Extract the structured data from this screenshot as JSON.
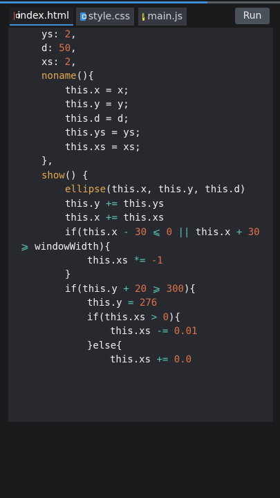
{
  "tabs": [
    {
      "label": "index.html",
      "icon": "html-file-icon",
      "active": true
    },
    {
      "label": "style.css",
      "icon": "css-file-icon",
      "active": false
    },
    {
      "label": "main.js",
      "icon": "js-file-icon",
      "active": false
    }
  ],
  "toolbar": {
    "run_label": "Run"
  },
  "colors": {
    "accent": "#3e8ede",
    "background": "#1b1b1e",
    "editor_background": "#27292e",
    "number": "#e0734c",
    "function_name": "#e4a851",
    "operator": "#59c3b3",
    "text": "#eef0f2"
  },
  "code": {
    "l1": {
      "a": "ys: ",
      "b": "2",
      "c": ","
    },
    "l2": {
      "a": "d: ",
      "b": "50",
      "c": ","
    },
    "l3": {
      "a": "xs: ",
      "b": "2",
      "c": ","
    },
    "l4": {
      "a": "noname",
      "b": "(){"
    },
    "l5": {
      "a": "this.x = x;"
    },
    "l6": {
      "a": "this.y = y;"
    },
    "l7": {
      "a": "this.d = d;"
    },
    "l8": {
      "a": "this.ys = ys;"
    },
    "l9": {
      "a": "this.xs = xs;"
    },
    "l10": {
      "a": "},"
    },
    "l11": {
      "a": "show",
      "b": "() {"
    },
    "l12": {
      "a": "ellipse",
      "b": "(this.x, this.y, this.d)"
    },
    "l13": {
      "a": "this.y ",
      "b": "+=",
      "c": " this.ys"
    },
    "l14": {
      "a": "this.x ",
      "b": "+=",
      "c": " this.xs"
    },
    "l15": {
      "a": "if(this.x ",
      "b": "-",
      "c": " ",
      "d": "30",
      "e": " ",
      "f": "⩽",
      "g": " ",
      "h": "0",
      "i": " ",
      "j": "||",
      "k": " this.x ",
      "l": "+",
      "m": " ",
      "n": "30"
    },
    "l16": {
      "a": "⩾",
      "b": " windowWidth){"
    },
    "l17": {
      "a": "this.xs ",
      "b": "*=",
      "c": " ",
      "d": "-1"
    },
    "l18": {
      "a": "}"
    },
    "l19": {
      "a": "if(this.y ",
      "b": "+",
      "c": " ",
      "d": "20",
      "e": " ",
      "f": "⩾",
      "g": " ",
      "h": "300",
      "i": "){"
    },
    "l20": {
      "a": "this.y ",
      "b": "=",
      "c": " ",
      "d": "276"
    },
    "l21": {
      "a": "if(this.xs ",
      "b": ">",
      "c": " ",
      "d": "0",
      "e": "){"
    },
    "l22": {
      "a": "this.xs ",
      "b": "-=",
      "c": " ",
      "d": "0.01"
    },
    "l23": {
      "a": "}else{"
    },
    "l24": {
      "a": "this.xs ",
      "b": "+=",
      "c": " ",
      "d": "0.0"
    }
  }
}
